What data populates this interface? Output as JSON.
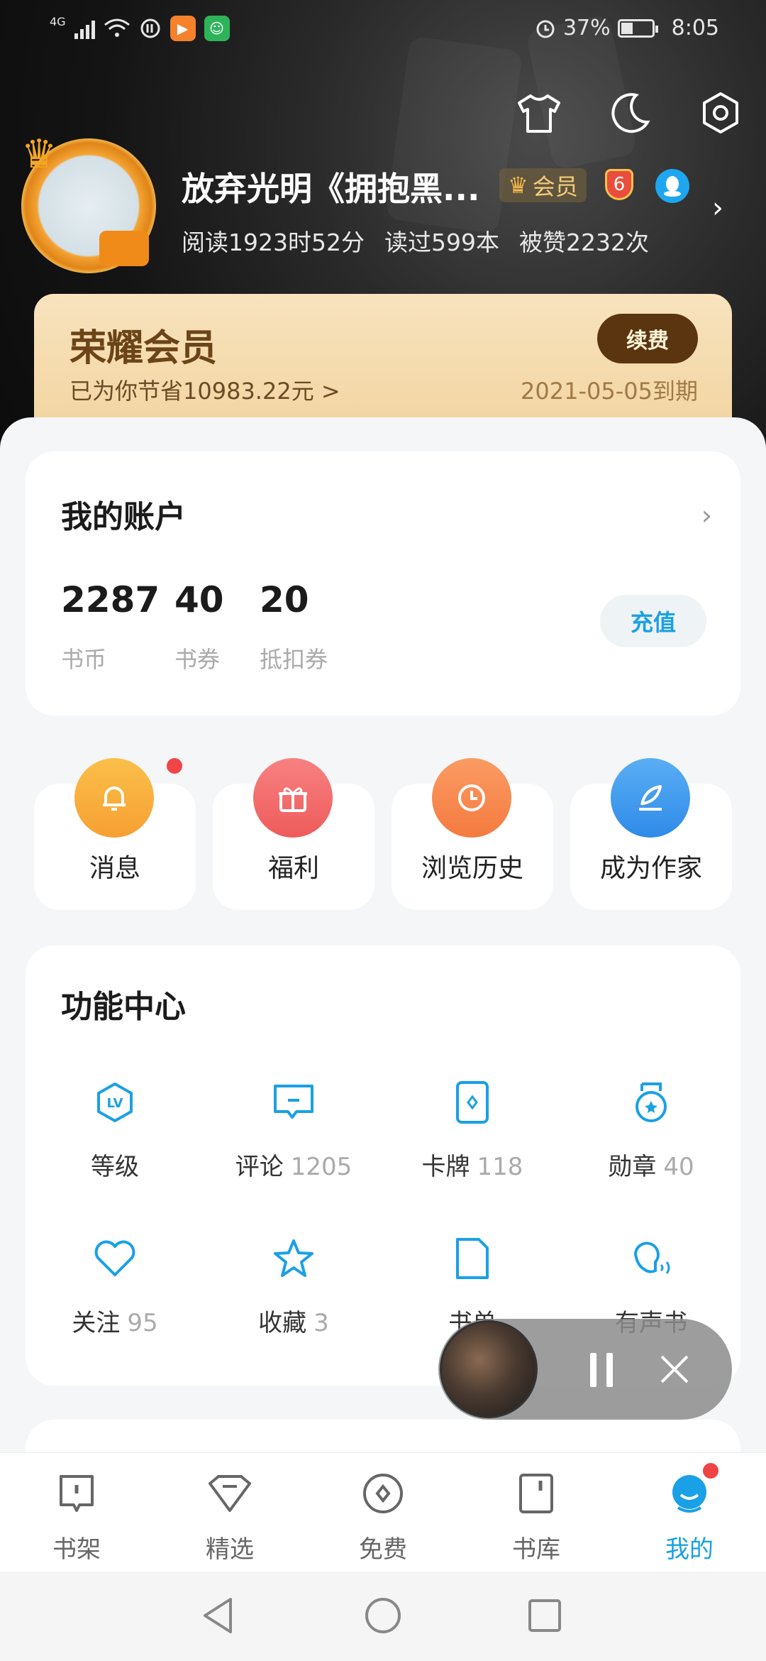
{
  "status_bar": {
    "network": "4G",
    "battery": "37%",
    "time": "8:05"
  },
  "profile": {
    "name": "放弃光明《拥抱黑...",
    "vip_tag": "会员",
    "level": "6",
    "stats": [
      "阅读1923时52分",
      "读过599本",
      "被赞2232次"
    ]
  },
  "vip_card": {
    "title": "荣耀会员",
    "savings": "已为你节省10983.22元 >",
    "button": "续费",
    "expire": "2021-05-05到期"
  },
  "account": {
    "title": "我的账户",
    "items": [
      {
        "value": "2287",
        "label": "书币"
      },
      {
        "value": "40",
        "label": "书券"
      },
      {
        "value": "20",
        "label": "抵扣券"
      }
    ],
    "recharge": "充值"
  },
  "quick_actions": [
    {
      "label": "消息",
      "color": "#f7a93a"
    },
    {
      "label": "福利",
      "color": "#f06a6a"
    },
    {
      "label": "浏览历史",
      "color": "#f88a4e"
    },
    {
      "label": "成为作家",
      "color": "#3f9cf0"
    }
  ],
  "function_center": {
    "title": "功能中心",
    "items": [
      {
        "label": "等级",
        "count": ""
      },
      {
        "label": "评论",
        "count": "1205"
      },
      {
        "label": "卡牌",
        "count": "118"
      },
      {
        "label": "勋章",
        "count": "40"
      },
      {
        "label": "关注",
        "count": "95"
      },
      {
        "label": "收藏",
        "count": "3"
      },
      {
        "label": "书单",
        "count": ""
      },
      {
        "label": "有声书",
        "count": ""
      }
    ]
  },
  "bottom_nav": [
    {
      "label": "书架"
    },
    {
      "label": "精选"
    },
    {
      "label": "免费"
    },
    {
      "label": "书库"
    },
    {
      "label": "我的"
    }
  ],
  "colors": {
    "accent": "#1aa0e6",
    "vip_brown": "#5a3510",
    "badge_red": "#f04545"
  }
}
